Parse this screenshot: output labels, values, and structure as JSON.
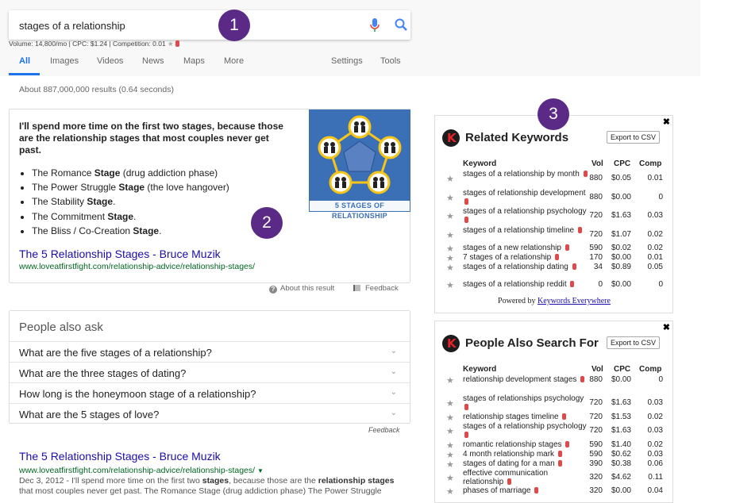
{
  "search": {
    "query": "stages of a relationship",
    "metrics": "Volume: 14,800/mo | CPC: $1.24 | Competition: 0.01"
  },
  "tabs": [
    "All",
    "Images",
    "Videos",
    "News",
    "Maps",
    "More",
    "Settings",
    "Tools"
  ],
  "stats": "About 887,000,000 results (0.64 seconds)",
  "badges": [
    "1",
    "2",
    "3"
  ],
  "snippet": {
    "lead": "I'll spend more time on the first two stages, because those are the relationship stages that most couples never get past.",
    "items": [
      {
        "pre": "The Romance ",
        "bold": "Stage",
        "post": " (drug addiction phase)"
      },
      {
        "pre": "The Power Struggle ",
        "bold": "Stage",
        "post": " (the love hangover)"
      },
      {
        "pre": "The Stability ",
        "bold": "Stage",
        "post": "."
      },
      {
        "pre": "The Commitment ",
        "bold": "Stage",
        "post": "."
      },
      {
        "pre": "The Bliss / Co-Creation ",
        "bold": "Stage",
        "post": "."
      }
    ],
    "image_caption": "5 STAGES OF RELATIONSHIP",
    "title": "The 5 Relationship Stages - Bruce Muzik",
    "url": "www.loveatfirstfight.com/relationship-advice/relationship-stages/",
    "about": "About this result",
    "feedback": "Feedback"
  },
  "paa": {
    "heading": "People also ask",
    "questions": [
      "What are the five stages of a relationship?",
      "What are the three stages of dating?",
      "How long is the honeymoon stage of a relationship?",
      "What are the 5 stages of love?"
    ],
    "feedback": "Feedback"
  },
  "result2": {
    "title": "The 5 Relationship Stages - Bruce Muzik",
    "url": "www.loveatfirstfight.com/relationship-advice/relationship-stages/",
    "date": "Dec 3, 2012 - ",
    "desc_a": "I'll spend more time on the first two ",
    "desc_b": "stages",
    "desc_c": ", because those are the ",
    "desc_d": "relationship stages",
    "line2": "that most couples never get past. The Romance Stage (drug addiction phase) The Power Struggle"
  },
  "related": {
    "title": "Related Keywords",
    "export": "Export to CSV",
    "close": "✖",
    "columns": {
      "keyword": "Keyword",
      "vol": "Vol",
      "cpc": "CPC",
      "comp": "Comp"
    },
    "rows": [
      {
        "kw": "stages of a relationship by month",
        "vol": "880",
        "cpc": "$0.05",
        "comp": "0.01"
      },
      {
        "kw": "stages of relationship development",
        "vol": "880",
        "cpc": "$0.00",
        "comp": "0"
      },
      {
        "kw": "stages of a relationship psychology",
        "vol": "720",
        "cpc": "$1.63",
        "comp": "0.03"
      },
      {
        "kw": "stages of a relationship timeline",
        "vol": "720",
        "cpc": "$1.07",
        "comp": "0.02"
      },
      {
        "kw": "stages of a new relationship",
        "vol": "590",
        "cpc": "$0.02",
        "comp": "0.02"
      },
      {
        "kw": "7 stages of a relationship",
        "vol": "170",
        "cpc": "$0.00",
        "comp": "0.01"
      },
      {
        "kw": "stages of a relationship dating",
        "vol": "34",
        "cpc": "$0.89",
        "comp": "0.05"
      },
      {
        "kw": "stages of a relationship reddit",
        "vol": "0",
        "cpc": "$0.00",
        "comp": "0"
      }
    ],
    "powered_by": "Powered by ",
    "powered_link": "Keywords Everywhere"
  },
  "alsosearch": {
    "title": "People Also Search For",
    "export": "Export to CSV",
    "close": "✖",
    "columns": {
      "keyword": "Keyword",
      "vol": "Vol",
      "cpc": "CPC",
      "comp": "Comp"
    },
    "rows": [
      {
        "kw": "relationship development stages",
        "vol": "880",
        "cpc": "$0.00",
        "comp": "0"
      },
      {
        "kw": "stages of relationships psychology",
        "vol": "720",
        "cpc": "$1.63",
        "comp": "0.03"
      },
      {
        "kw": "relationship stages timeline",
        "vol": "720",
        "cpc": "$1.53",
        "comp": "0.02"
      },
      {
        "kw": "stages of a relationship psychology",
        "vol": "720",
        "cpc": "$1.63",
        "comp": "0.03"
      },
      {
        "kw": "romantic relationship stages",
        "vol": "590",
        "cpc": "$1.40",
        "comp": "0.02"
      },
      {
        "kw": "4 month relationship mark",
        "vol": "590",
        "cpc": "$0.62",
        "comp": "0.03"
      },
      {
        "kw": "stages of dating for a man",
        "vol": "390",
        "cpc": "$0.38",
        "comp": "0.06"
      },
      {
        "kw": "effective communication relationship",
        "vol": "320",
        "cpc": "$4.62",
        "comp": "0.11"
      },
      {
        "kw": "phases of marriage",
        "vol": "320",
        "cpc": "$0.00",
        "comp": "0.04"
      }
    ]
  },
  "colors": {
    "accent": "#1a73e8",
    "link": "#1a0dab",
    "url": "#006621",
    "badge": "#5b2a86",
    "db": "#e04949"
  }
}
